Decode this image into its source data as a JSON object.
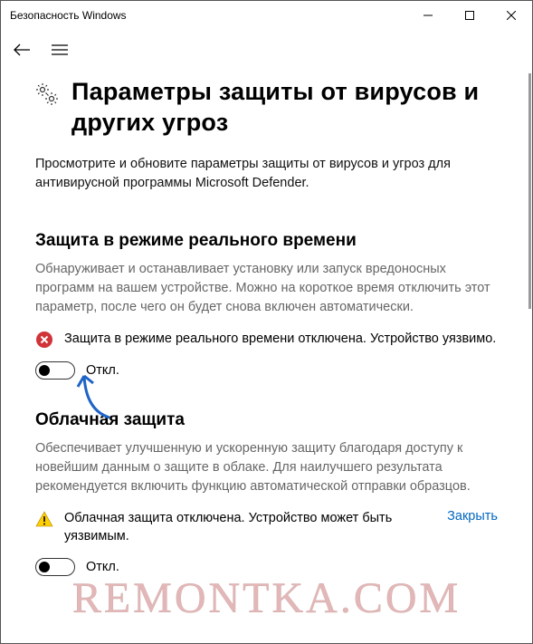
{
  "window": {
    "title": "Безопасность Windows"
  },
  "page": {
    "heading": "Параметры защиты от вирусов и других угроз",
    "subtitle": "Просмотрите и обновите параметры защиты от вирусов и угроз для антивирусной программы Microsoft Defender."
  },
  "sections": {
    "realtime": {
      "title": "Защита в режиме реального времени",
      "desc": "Обнаруживает и останавливает установку или запуск вредоносных программ на вашем устройстве. Можно на короткое время отключить этот параметр, после чего он будет снова включен автоматически.",
      "alert_text": "Защита в режиме реального времени отключена. Устройство уязвимо.",
      "toggle_label": "Откл."
    },
    "cloud": {
      "title": "Облачная защита",
      "desc": "Обеспечивает улучшенную и ускоренную защиту благодаря доступу к новейшим данным о защите в облаке. Для наилучшего результата рекомендуется включить функцию автоматической отправки образцов.",
      "alert_text": "Облачная защита отключена. Устройство может быть уязвимым.",
      "alert_link": "Закрыть",
      "toggle_label": "Откл."
    }
  },
  "watermark": "REMONTKA.COM"
}
